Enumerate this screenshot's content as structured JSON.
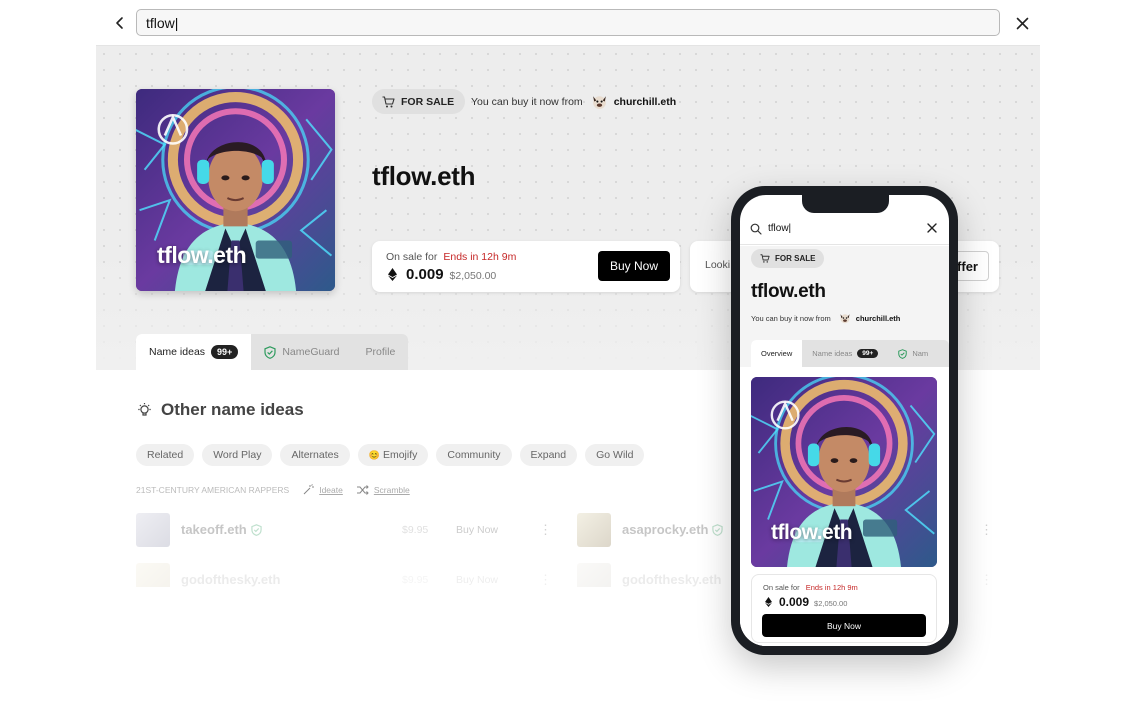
{
  "search": {
    "value": "tflow|"
  },
  "profile": {
    "name": "tflow.eth",
    "avatar_label": "tflow.eth",
    "sale_badge": "FOR SALE",
    "buy_from_text": "You can buy it now from",
    "seller": "churchill.eth"
  },
  "listing": {
    "on_sale_label": "On sale for",
    "ends_text": "Ends in 12h 9m",
    "price_eth": "0.009",
    "price_usd": "$2,050.00",
    "buy_button": "Buy Now"
  },
  "offer": {
    "look_text": "Looki",
    "button_text": "ffer"
  },
  "tabs": [
    {
      "label": "Name ideas",
      "count": "99+"
    },
    {
      "label": "NameGuard"
    },
    {
      "label": "Profile"
    }
  ],
  "ideas": {
    "title": "Other name ideas",
    "chips": [
      "Related",
      "Word Play",
      "Alternates",
      "Emojify",
      "Community",
      "Expand",
      "Go Wild"
    ],
    "emojify_icon": "😊",
    "category": "21ST-CENTURY AMERICAN RAPPERS",
    "ideate": "Ideate",
    "scramble": "Scramble",
    "results": [
      {
        "name": "takeoff.eth",
        "price": "$9.95",
        "action": "Buy Now"
      },
      {
        "name": "asaprocky.eth"
      },
      {
        "name": "godofthesky.eth",
        "price": "$9.95",
        "action": "Buy Now"
      },
      {
        "name": "godofthesky.eth"
      }
    ],
    "more_icon": "⋮"
  },
  "mobile": {
    "search_value": "tflow|",
    "tabs": [
      {
        "label": "Overview"
      },
      {
        "label": "Name ideas",
        "count": "99+"
      },
      {
        "label": "Nam"
      }
    ]
  },
  "colors": {
    "accent_red": "#c62828",
    "shield_green": "#2e9b5e",
    "button_black": "#000000"
  }
}
